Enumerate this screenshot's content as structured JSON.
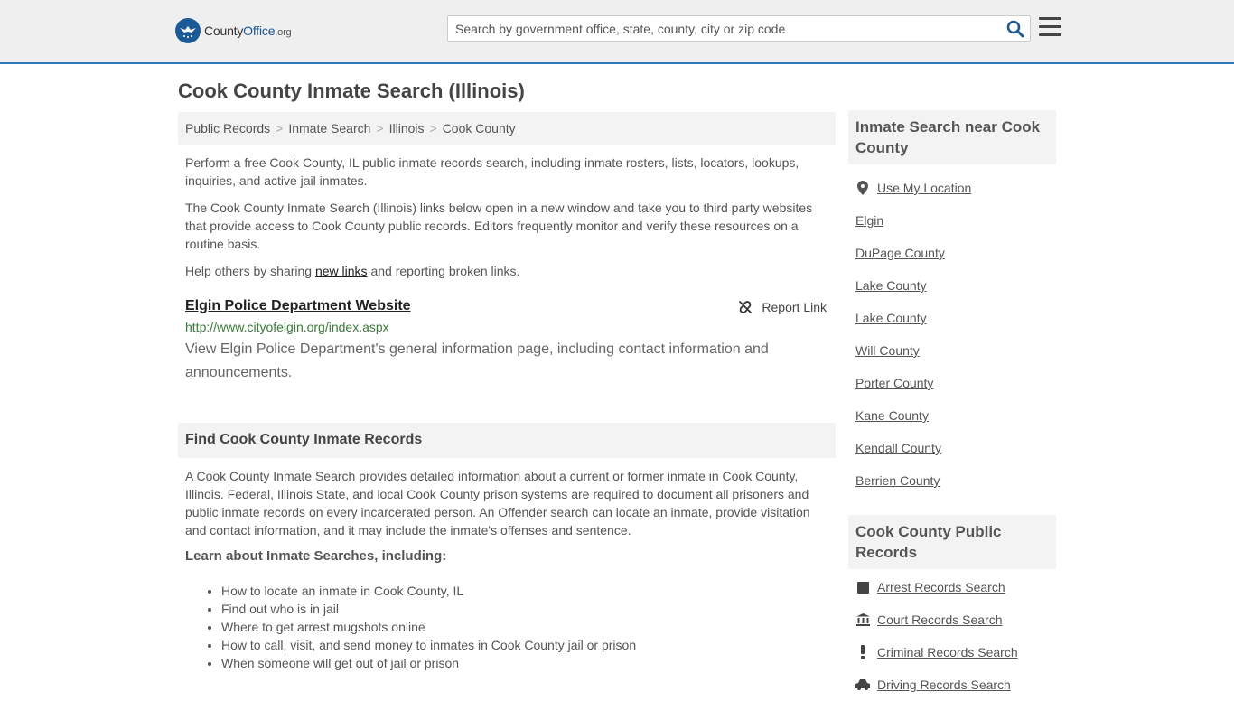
{
  "header": {
    "logo_brand_prefix": "County",
    "logo_brand_main": "Office",
    "logo_tld": ".org",
    "search_placeholder": "Search by government office, state, county, city or zip code"
  },
  "page_title": "Cook County Inmate Search (Illinois)",
  "breadcrumb": [
    "Public Records",
    "Inmate Search",
    "Illinois",
    "Cook County"
  ],
  "breadcrumb_sep": ">",
  "intro": {
    "p1": "Perform a free Cook County, IL public inmate records search, including inmate rosters, lists, locators, lookups, inquiries, and active jail inmates.",
    "p2": "The Cook County Inmate Search (Illinois) links below open in a new window and take you to third party websites that provide access to Cook County public records. Editors frequently monitor and verify these resources on a routine basis.",
    "p3_before": "Help others by sharing ",
    "p3_link": "new links",
    "p3_after": " and reporting broken links."
  },
  "link_item": {
    "title": "Elgin Police Department Website",
    "report_label": "Report Link",
    "url": "http://www.cityofelgin.org/index.aspx",
    "description": "View Elgin Police Department's general information page, including contact information and announcements."
  },
  "find_section": {
    "heading": "Find Cook County Inmate Records",
    "body": "A Cook County Inmate Search provides detailed information about a current or former inmate in Cook County, Illinois. Federal, Illinois State, and local Cook County prison systems are required to document all prisoners and public inmate records on every incarcerated person. An Offender search can locate an inmate, provide visitation and contact information, and it may include the inmate's offenses and sentence.",
    "learn_heading": "Learn about Inmate Searches, including:",
    "learn_items": [
      "How to locate an inmate in Cook County, IL",
      "Find out who is in jail",
      "Where to get arrest mugshots online",
      "How to call, visit, and send money to inmates in Cook County jail or prison",
      "When someone will get out of jail or prison"
    ]
  },
  "sidebar": {
    "near_heading": "Inmate Search near Cook County",
    "use_location": "Use My Location",
    "near_items": [
      "Elgin",
      "DuPage County",
      "Lake County",
      "Lake County",
      "Will County",
      "Porter County",
      "Kane County",
      "Kendall County",
      "Berrien County"
    ],
    "records_heading": "Cook County Public Records",
    "records_items": [
      {
        "label": "Arrest Records Search",
        "icon": "square-icon"
      },
      {
        "label": "Court Records Search",
        "icon": "courthouse-icon"
      },
      {
        "label": "Criminal Records Search",
        "icon": "exclamation-icon"
      },
      {
        "label": "Driving Records Search",
        "icon": "car-icon"
      }
    ]
  },
  "colors": {
    "accent": "#2a78b8",
    "logo_blue": "#1c5a96",
    "url_green": "#3a7a3a",
    "panel_gray": "#f3f3f3"
  }
}
